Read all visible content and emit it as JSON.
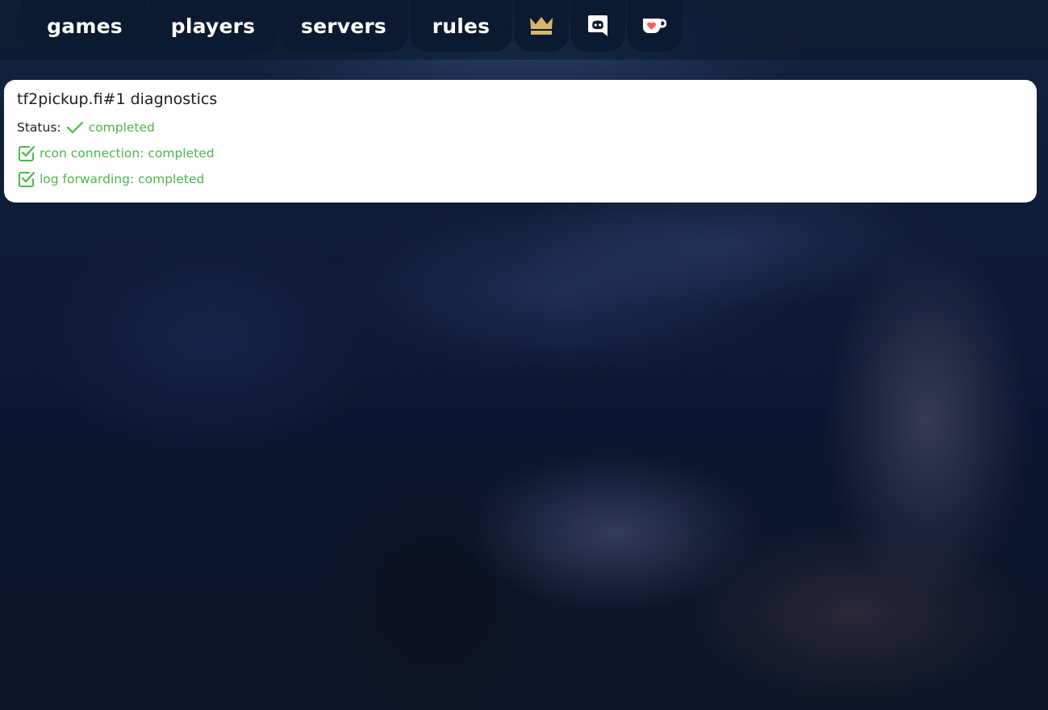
{
  "nav": {
    "games": "games",
    "players": "players",
    "servers": "servers",
    "rules": "rules",
    "icons": [
      "crown-icon",
      "discord-icon",
      "ko-fi-icon"
    ]
  },
  "diagnostics": {
    "title": "tf2pickup.fi#1 diagnostics",
    "status_label": "Status:",
    "status_value": "completed",
    "checks": [
      {
        "label": "rcon connection: completed"
      },
      {
        "label": "log forwarding: completed"
      }
    ]
  },
  "colors": {
    "success": "#4bb84a",
    "crown": "#d9b46c",
    "kofi_heart": "#ff5e5b",
    "nav_bg": "#0b1a30"
  }
}
